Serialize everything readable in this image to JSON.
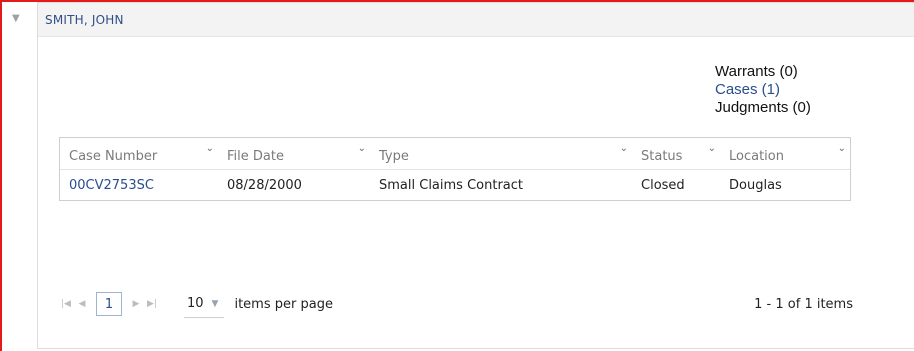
{
  "party": {
    "name": "SMITH, JOHN"
  },
  "summary": {
    "warrants": "Warrants (0)",
    "cases": "Cases (1)",
    "judgments": "Judgments (0)"
  },
  "grid": {
    "columns": [
      "Case Number",
      "File Date",
      "Type",
      "Status",
      "Location"
    ],
    "rows": [
      {
        "case_number": "00CV2753SC",
        "file_date": "08/28/2000",
        "type": "Small Claims Contract",
        "status": "Closed",
        "location": "Douglas"
      }
    ]
  },
  "pager": {
    "current_page": "1",
    "page_size": "10",
    "per_page_label": "items per page",
    "info": "1 - 1 of 1 items"
  },
  "colors": {
    "accent_link": "#2a4d8f",
    "frame": "#e31b1b"
  }
}
